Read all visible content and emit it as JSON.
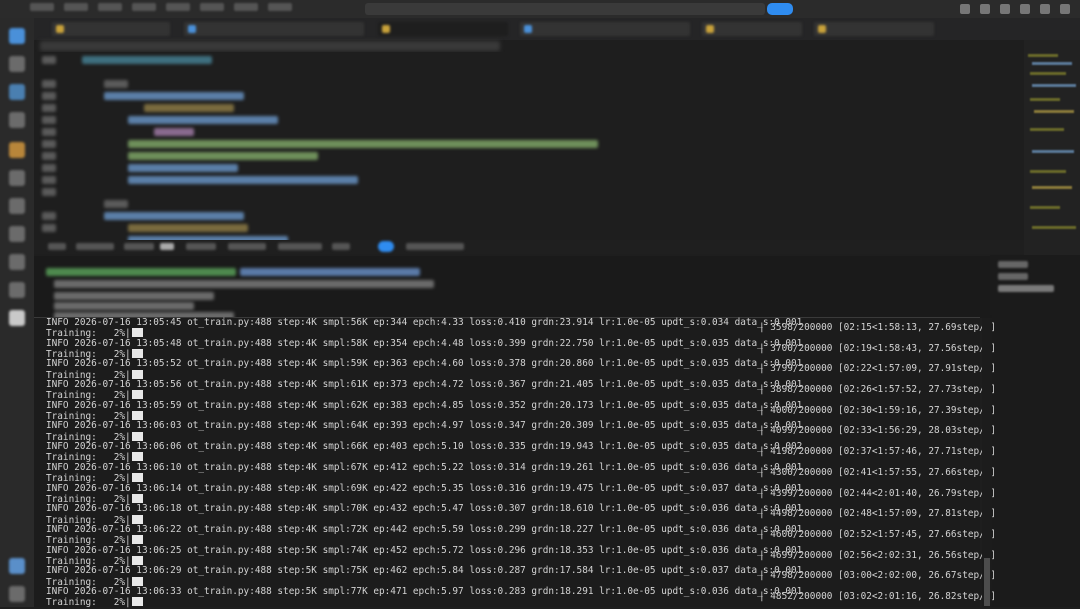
{
  "terminal": {
    "lines": [
      {
        "kind": "info",
        "text": "INFO 2026-07-16 13:05:45 ot_train.py:488 step:4K smpl:56K ep:344 epch:4.33 loss:0.410 grdn:23.914 lr:1.0e-05 updt_s:0.034 data_s:0.001"
      },
      {
        "kind": "train",
        "text": "Training:   2%|"
      },
      {
        "kind": "info",
        "text": "INFO 2026-07-16 13:05:48 ot_train.py:488 step:4K smpl:58K ep:354 epch:4.48 loss:0.399 grdn:22.750 lr:1.0e-05 updt_s:0.035 data_s:0.001"
      },
      {
        "kind": "train",
        "text": "Training:   2%|"
      },
      {
        "kind": "info",
        "text": "INFO 2026-07-16 13:05:52 ot_train.py:488 step:4K smpl:59K ep:363 epch:4.60 loss:0.378 grdn:20.860 lr:1.0e-05 updt_s:0.035 data_s:0.001"
      },
      {
        "kind": "train",
        "text": "Training:   2%|"
      },
      {
        "kind": "info",
        "text": "INFO 2026-07-16 13:05:56 ot_train.py:488 step:4K smpl:61K ep:373 epch:4.72 loss:0.367 grdn:21.405 lr:1.0e-05 updt_s:0.035 data_s:0.001"
      },
      {
        "kind": "train",
        "text": "Training:   2%|"
      },
      {
        "kind": "info",
        "text": "INFO 2026-07-16 13:05:59 ot_train.py:488 step:4K smpl:62K ep:383 epch:4.85 loss:0.352 grdn:20.173 lr:1.0e-05 updt_s:0.035 data_s:0.001"
      },
      {
        "kind": "train",
        "text": "Training:   2%|"
      },
      {
        "kind": "info",
        "text": "INFO 2026-07-16 13:06:03 ot_train.py:488 step:4K smpl:64K ep:393 epch:4.97 loss:0.347 grdn:20.309 lr:1.0e-05 updt_s:0.035 data_s:0.001"
      },
      {
        "kind": "train",
        "text": "Training:   2%|"
      },
      {
        "kind": "info",
        "text": "INFO 2026-07-16 13:06:06 ot_train.py:488 step:4K smpl:66K ep:403 epch:5.10 loss:0.335 grdn:19.943 lr:1.0e-05 updt_s:0.035 data_s:0.002"
      },
      {
        "kind": "train",
        "text": "Training:   2%|"
      },
      {
        "kind": "info",
        "text": "INFO 2026-07-16 13:06:10 ot_train.py:488 step:4K smpl:67K ep:412 epch:5.22 loss:0.314 grdn:19.261 lr:1.0e-05 updt_s:0.036 data_s:0.001"
      },
      {
        "kind": "train",
        "text": "Training:   2%|"
      },
      {
        "kind": "info",
        "text": "INFO 2026-07-16 13:06:14 ot_train.py:488 step:4K smpl:69K ep:422 epch:5.35 loss:0.316 grdn:19.475 lr:1.0e-05 updt_s:0.037 data_s:0.001"
      },
      {
        "kind": "train",
        "text": "Training:   2%|"
      },
      {
        "kind": "info",
        "text": "INFO 2026-07-16 13:06:18 ot_train.py:488 step:4K smpl:70K ep:432 epch:5.47 loss:0.307 grdn:18.610 lr:1.0e-05 updt_s:0.036 data_s:0.001"
      },
      {
        "kind": "train",
        "text": "Training:   2%|"
      },
      {
        "kind": "info",
        "text": "INFO 2026-07-16 13:06:22 ot_train.py:488 step:4K smpl:72K ep:442 epch:5.59 loss:0.299 grdn:18.227 lr:1.0e-05 updt_s:0.036 data_s:0.001"
      },
      {
        "kind": "train",
        "text": "Training:   2%|"
      },
      {
        "kind": "info",
        "text": "INFO 2026-07-16 13:06:25 ot_train.py:488 step:5K smpl:74K ep:452 epch:5.72 loss:0.296 grdn:18.353 lr:1.0e-05 updt_s:0.036 data_s:0.001"
      },
      {
        "kind": "train",
        "text": "Training:   2%|"
      },
      {
        "kind": "info",
        "text": "INFO 2026-07-16 13:06:29 ot_train.py:488 step:5K smpl:75K ep:462 epch:5.84 loss:0.287 grdn:17.584 lr:1.0e-05 updt_s:0.037 data_s:0.001"
      },
      {
        "kind": "train",
        "text": "Training:   2%|"
      },
      {
        "kind": "info",
        "text": "INFO 2026-07-16 13:06:33 ot_train.py:488 step:5K smpl:77K ep:471 epch:5.97 loss:0.283 grdn:18.291 lr:1.0e-05 updt_s:0.036 data_s:0.001"
      },
      {
        "kind": "train",
        "text": "Training:   2%|"
      }
    ],
    "progress": [
      "| 3598/200000 [02:15<1:58:13, 27.69step/s]",
      "| 3700/200000 [02:19<1:58:43, 27.56step/s]",
      "| 3799/200000 [02:22<1:57:09, 27.91step/s]",
      "| 3898/200000 [02:26<1:57:52, 27.73step/s]",
      "| 4000/200000 [02:30<1:59:16, 27.39step/s]",
      "| 4099/200000 [02:33<1:56:29, 28.03step/s]",
      "| 4198/200000 [02:37<1:57:46, 27.71step/s]",
      "| 4300/200000 [02:41<1:57:55, 27.66step/s]",
      "| 4399/200000 [02:44<2:01:40, 26.79step/s]",
      "| 4498/200000 [02:48<1:57:09, 27.81step/s]",
      "| 4600/200000 [02:52<1:57:45, 27.66step/s]",
      "| 4699/200000 [02:56<2:02:31, 26.56step/s]",
      "| 4798/200000 [03:00<2:02:00, 26.67step/s]",
      "| 4852/200000 [03:02<2:01:16, 26.82step/s]"
    ]
  },
  "colors": {
    "accent": "#2f8cf0",
    "terminal_bg": "#1c1c1c",
    "editor_bg": "#1e1e1e"
  }
}
